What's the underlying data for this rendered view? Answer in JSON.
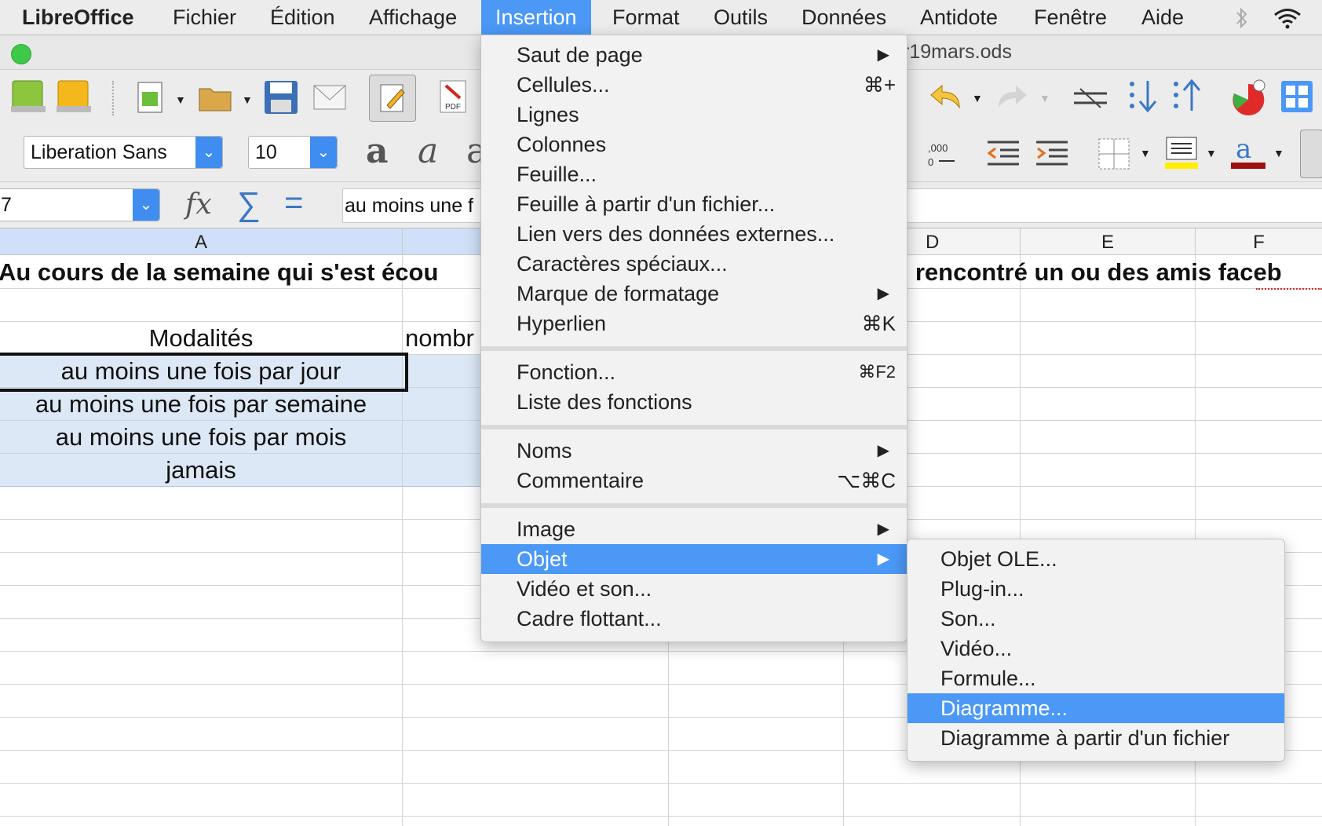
{
  "menubar": {
    "app_name": "LibreOffice",
    "items": [
      "Fichier",
      "Édition",
      "Affichage",
      "Insertion",
      "Format",
      "Outils",
      "Données",
      "Antidote",
      "Fenêtre",
      "Aide"
    ],
    "active": "Insertion"
  },
  "window": {
    "title_partial": "r19mars.ods"
  },
  "toolbar": {
    "font_name": "Liberation Sans",
    "font_size": "10",
    "pdf_label": "PDF"
  },
  "formula_bar": {
    "cell_ref_partial": "7",
    "content_partial": "au moins une f"
  },
  "columns": [
    "A",
    "D",
    "E",
    "F"
  ],
  "sheet": {
    "title_left": "Au cours de la semaine qui s'est écou",
    "title_right": "s rencontré un ou des amis faceb",
    "header_a": "Modalités",
    "header_b_partial": "nombr",
    "rows": [
      "au moins une fois par jour",
      "au moins une fois par semaine",
      "au moins une fois par mois",
      "jamais"
    ]
  },
  "insert_menu": {
    "items": [
      {
        "label": "Saut de page",
        "submenu": true
      },
      {
        "label": "Cellules...",
        "shortcut": "⌘+"
      },
      {
        "label": "Lignes"
      },
      {
        "label": "Colonnes"
      },
      {
        "label": "Feuille..."
      },
      {
        "label": "Feuille à partir d'un fichier..."
      },
      {
        "label": "Lien vers des données externes..."
      },
      {
        "label": "Caractères spéciaux..."
      },
      {
        "label": "Marque de formatage",
        "submenu": true
      },
      {
        "label": "Hyperlien",
        "shortcut": "⌘K"
      },
      {
        "label": "Fonction...",
        "shortcut": "⌘F2"
      },
      {
        "label": "Liste des fonctions"
      },
      {
        "label": "Noms",
        "submenu": true
      },
      {
        "label": "Commentaire",
        "shortcut": "⌥⌘C"
      },
      {
        "label": "Image",
        "submenu": true
      },
      {
        "label": "Objet",
        "submenu": true,
        "highlighted": true
      },
      {
        "label": "Vidéo et son..."
      },
      {
        "label": "Cadre flottant..."
      }
    ]
  },
  "object_submenu": {
    "items": [
      {
        "label": "Objet OLE..."
      },
      {
        "label": "Plug-in..."
      },
      {
        "label": "Son..."
      },
      {
        "label": "Vidéo..."
      },
      {
        "label": "Formule..."
      },
      {
        "label": "Diagramme...",
        "highlighted": true
      },
      {
        "label": "Diagramme à partir d'un fichier"
      }
    ]
  },
  "colors": {
    "accent": "#4b98f6",
    "selection": "#dde8f6"
  }
}
